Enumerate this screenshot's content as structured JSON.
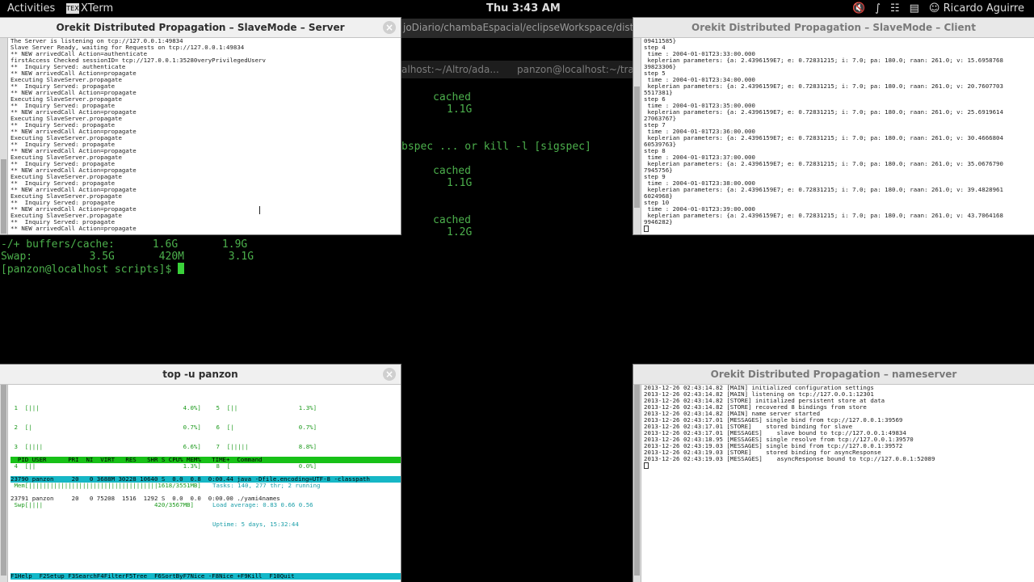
{
  "topbar": {
    "activities": "Activities",
    "app_icon_text": "TEX",
    "app_name": "XTerm",
    "clock": "Thu  3:43 AM",
    "user": "Ricardo Aguirre",
    "tray_icons": [
      "volume-muted-icon",
      "bluetooth-icon",
      "wifi-icon",
      "clipboard-icon",
      "user-icon"
    ]
  },
  "background_terminal": {
    "title_partial": "joDiario/chambaEspacial/eclipseWorkspace/distrib",
    "tab1": "alhost:~/Altro/ada...",
    "tab2": "panzon@localhost:~/trabajo",
    "lines": [
      "cached",
      "1.1G",
      "bspec ... or kill -l [sigspec]",
      "cached",
      "1.1G",
      "cached",
      "1.2G",
      "-/+ buffers/cache:      1.6G       1.9G",
      "Swap:         3.5G       420M       3.1G",
      "[panzon@localhost scripts]$ "
    ]
  },
  "server_window": {
    "title": "Orekit Distributed Propagation – SlaveMode – Server",
    "lines": [
      "The Server is listening on tcp://127.0.0.1:49834",
      "Slave Server Ready, waiting for Requests on tcp://127.0.0.1:49834",
      "** NEW arrivedCall Action=authenticate",
      "firstAccess Checked sessionID= tcp://127.0.0.1:35280veryPrivilegedUserv",
      "**  Inquiry Served: authenticate",
      "** NEW arrivedCall Action=propagate",
      "Executing SlaveServer.propagate",
      "**  Inquiry Served: propagate",
      "** NEW arrivedCall Action=propagate",
      "Executing SlaveServer.propagate",
      "**  Inquiry Served: propagate",
      "** NEW arrivedCall Action=propagate",
      "Executing SlaveServer.propagate",
      "**  Inquiry Served: propagate",
      "** NEW arrivedCall Action=propagate",
      "Executing SlaveServer.propagate",
      "**  Inquiry Served: propagate",
      "** NEW arrivedCall Action=propagate",
      "Executing SlaveServer.propagate",
      "**  Inquiry Served: propagate",
      "** NEW arrivedCall Action=propagate",
      "Executing SlaveServer.propagate",
      "**  Inquiry Served: propagate",
      "** NEW arrivedCall Action=propagate",
      "Executing SlaveServer.propagate",
      "**  Inquiry Served: propagate",
      "** NEW arrivedCall Action=propagate",
      "Executing SlaveServer.propagate",
      "**  Inquiry Served: propagate",
      "** NEW arrivedCall Action=propagate"
    ]
  },
  "client_window": {
    "title": "Orekit Distributed Propagation – SlaveMode – Client",
    "lines": [
      "09411585}",
      "step 4",
      " time : 2004-01-01T23:33:00.000",
      " keplerian parameters: {a: 2.4396159E7; e: 0.72831215; i: 7.0; pa: 180.0; raan: 261.0; v: 15.6958768",
      "39823306}",
      "step 5",
      " time : 2004-01-01T23:34:00.000",
      " keplerian parameters: {a: 2.4396159E7; e: 0.72831215; i: 7.0; pa: 180.0; raan: 261.0; v: 20.7607703",
      "5517381}",
      "step 6",
      " time : 2004-01-01T23:35:00.000",
      " keplerian parameters: {a: 2.4396159E7; e: 0.72831215; i: 7.0; pa: 180.0; raan: 261.0; v: 25.6919614",
      "27063767}",
      "step 7",
      " time : 2004-01-01T23:36:00.000",
      " keplerian parameters: {a: 2.4396159E7; e: 0.72831215; i: 7.0; pa: 180.0; raan: 261.0; v: 30.4666804",
      "60539763}",
      "step 8",
      " time : 2004-01-01T23:37:00.000",
      " keplerian parameters: {a: 2.4396159E7; e: 0.72831215; i: 7.0; pa: 180.0; raan: 261.0; v: 35.0676790",
      "7945756}",
      "step 9",
      " time : 2004-01-01T23:38:00.000",
      " keplerian parameters: {a: 2.4396159E7; e: 0.72831215; i: 7.0; pa: 180.0; raan: 261.0; v: 39.4828961",
      "6024968}",
      "step 10",
      " time : 2004-01-01T23:39:00.000",
      " keplerian parameters: {a: 2.4396159E7; e: 0.72831215; i: 7.0; pa: 180.0; raan: 261.0; v: 43.7064168",
      "9946282}"
    ]
  },
  "htop_window": {
    "title": "top -u panzon",
    "cpu_left": [
      " 1  [|||                                        4.0%]",
      " 2  [|                                          0.7%]",
      " 3  [||||                                       6.6%]",
      " 4  [||                                         1.3%]"
    ],
    "cpu_right": [
      " 5  [||                 1.3%]",
      " 6  [|                  0.7%]",
      " 7  [|||||              8.8%]",
      " 8  [                   0.0%]"
    ],
    "mem": " Mem[||||||||||||||||||||||||||||||||||||1618/3551MB]",
    "swp": " Swp[||||                               420/3567MB]",
    "tasks": "Tasks: 140, 277 thr; 2 running",
    "load": "Load average: 0.83 0.66 0.56",
    "uptime": "Uptime: 5 days, 15:32:44",
    "header": "  PID USER      PRI  NI  VIRT   RES   SHR S CPU% MEM%   TIME+  Command",
    "rows": [
      "23790 panzon     20   0 3688M 30228 10640 S  0.0  0.8  0:00.44 java -Dfile.encoding=UTF-8 -classpath",
      "23791 panzon     20   0 75208  1516  1292 S  0.0  0.0  0:00.00 ./yami4names"
    ],
    "function_keys": "F1Help  F2Setup F3SearchF4FilterF5Tree  F6SortByF7Nice -F8Nice +F9Kill  F10Quit"
  },
  "nameserver_window": {
    "title": "Orekit Distributed Propagation – nameserver",
    "lines": [
      "2013-12-26 02:43:14.82 [MAIN] initialized configuration settings",
      "2013-12-26 02:43:14.82 [MAIN] listening on tcp://127.0.0.1:12301",
      "2013-12-26 02:43:14.82 [STORE] initialized persistent store at data",
      "2013-12-26 02:43:14.82 [STORE] recovered 8 bindings from store",
      "2013-12-26 02:43:14.82 [MAIN] name server started",
      "2013-12-26 02:43:17.01 [MESSAGES] single bind from tcp://127.0.0.1:39569",
      "2013-12-26 02:43:17.01 [STORE]    stored binding for slave",
      "2013-12-26 02:43:17.01 [MESSAGES]    slave bound to tcp://127.0.0.1:49834",
      "2013-12-26 02:43:18.95 [MESSAGES] single resolve from tcp://127.0.0.1:39570",
      "2013-12-26 02:43:19.03 [MESSAGES] single bind from tcp://127.0.0.1:39572",
      "2013-12-26 02:43:19.03 [STORE]    stored binding for asyncResponse",
      "2013-12-26 02:43:19.03 [MESSAGES]    asyncResponse bound to tcp://127.0.0.1:52089"
    ]
  }
}
